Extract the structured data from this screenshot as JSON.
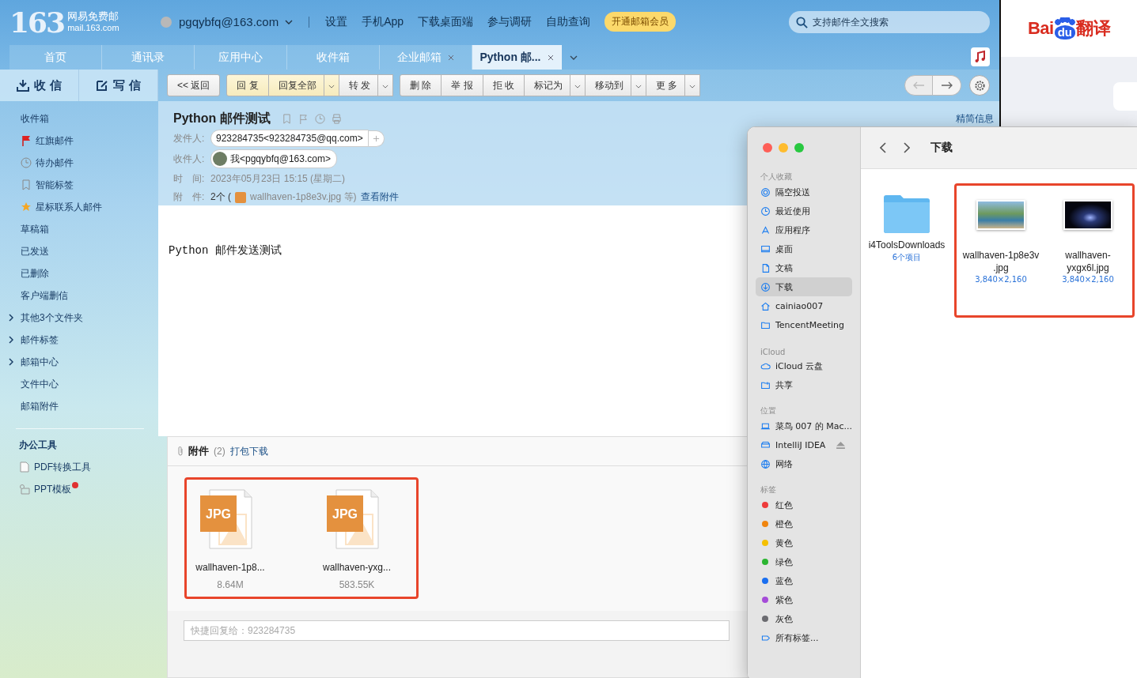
{
  "mail": {
    "logo": {
      "number": "163",
      "name": "网易免费邮",
      "domain": "mail.163.com"
    },
    "account": "pgqybfq@163.com",
    "top_links": [
      "设置",
      "手机App",
      "下载桌面端",
      "参与调研",
      "自助查询"
    ],
    "vip_button": "开通邮箱会员",
    "search": {
      "placeholder": "支持邮件全文搜索"
    },
    "nav_tabs": [
      {
        "label": "首页",
        "selected": false,
        "closable": false
      },
      {
        "label": "通讯录",
        "selected": false,
        "closable": false
      },
      {
        "label": "应用中心",
        "selected": false,
        "closable": false
      },
      {
        "label": "收件箱",
        "selected": false,
        "closable": false
      },
      {
        "label": "企业邮箱",
        "selected": false,
        "closable": true
      },
      {
        "label": "Python 邮...",
        "selected": true,
        "closable": true
      }
    ],
    "receive_button": "收 信",
    "compose_button": "写 信",
    "sidebar": [
      {
        "label": "收件箱",
        "kind": "plain"
      },
      {
        "label": "红旗邮件",
        "kind": "flag"
      },
      {
        "label": "待办邮件",
        "kind": "clock"
      },
      {
        "label": "智能标签",
        "kind": "bookmark"
      },
      {
        "label": "星标联系人邮件",
        "kind": "star"
      },
      {
        "label": "草稿箱",
        "kind": "plain"
      },
      {
        "label": "已发送",
        "kind": "plain"
      },
      {
        "label": "已删除",
        "kind": "plain"
      },
      {
        "label": "客户端删信",
        "kind": "plain"
      },
      {
        "label": "其他3个文件夹",
        "kind": "expandable"
      },
      {
        "label": "邮件标签",
        "kind": "expandable"
      },
      {
        "label": "邮箱中心",
        "kind": "expandable"
      },
      {
        "label": "文件中心",
        "kind": "plain"
      },
      {
        "label": "邮箱附件",
        "kind": "plain"
      }
    ],
    "tools_heading": "办公工具",
    "tools": [
      {
        "label": "PDF转换工具",
        "kind": "pdf",
        "badge": false
      },
      {
        "label": "PPT模板",
        "kind": "ppt",
        "badge": true
      }
    ],
    "back_button": "<< 返回",
    "toolbar_groups": [
      [
        {
          "label": "回 复",
          "highlighted": true,
          "dropdown": false
        },
        {
          "label": "回复全部",
          "highlighted": true,
          "dropdown": true
        },
        {
          "label": "转 发",
          "highlighted": false,
          "dropdown": true
        }
      ],
      [
        {
          "label": "删 除",
          "highlighted": false,
          "dropdown": false
        },
        {
          "label": "举 报",
          "highlighted": false,
          "dropdown": false
        },
        {
          "label": "拒 收",
          "highlighted": false,
          "dropdown": false
        },
        {
          "label": "标记为",
          "highlighted": false,
          "dropdown": true
        },
        {
          "label": "移动到",
          "highlighted": false,
          "dropdown": true
        },
        {
          "label": "更 多",
          "highlighted": false,
          "dropdown": true
        }
      ]
    ],
    "message": {
      "subject": "Python 邮件测试",
      "summary_link": "精简信息",
      "from_label": "发件人:",
      "from": "923284735<923284735@qq.com>",
      "to_label": "收件人:",
      "to": "我<pgqybfq@163.com>",
      "time_label": "时　间:",
      "time": "2023年05月23日 15:15 (星期二)",
      "attach_label": "附　件:",
      "attach_count": "2个 (",
      "attach_name": "wallhaven-1p8e3v.jpg 等)",
      "attach_link": "查看附件",
      "body": "Python 邮件发送测试"
    },
    "attachments": {
      "title": "附件",
      "count": "(2)",
      "download_all": "打包下载",
      "highlight": true,
      "files": [
        {
          "type": "JPG",
          "name": "wallhaven-1p8...",
          "size": "8.64M"
        },
        {
          "type": "JPG",
          "name": "wallhaven-yxg...",
          "size": "583.55K"
        }
      ]
    },
    "quick_reply": {
      "placeholder": "快捷回复给：923284735"
    }
  },
  "baidu_logo": {
    "left": "Bai",
    "paw": "du",
    "right": "翻译"
  },
  "finder": {
    "title": "下载",
    "sections": [
      {
        "heading": "个人收藏",
        "items": [
          {
            "label": "隔空投送",
            "kind": "airdrop",
            "selected": false
          },
          {
            "label": "最近使用",
            "kind": "recent",
            "selected": false
          },
          {
            "label": "应用程序",
            "kind": "apps",
            "selected": false
          },
          {
            "label": "桌面",
            "kind": "desktop",
            "selected": false
          },
          {
            "label": "文稿",
            "kind": "doc",
            "selected": false
          },
          {
            "label": "下载",
            "kind": "download",
            "selected": true
          },
          {
            "label": "cainiao007",
            "kind": "home",
            "selected": false
          },
          {
            "label": "TencentMeeting",
            "kind": "folder",
            "selected": false
          }
        ]
      },
      {
        "heading": "iCloud",
        "items": [
          {
            "label": "iCloud 云盘",
            "kind": "cloud",
            "selected": false
          },
          {
            "label": "共享",
            "kind": "shared",
            "selected": false
          }
        ]
      },
      {
        "heading": "位置",
        "items": [
          {
            "label": "菜鸟 007 的 Mac...",
            "kind": "laptop",
            "selected": false
          },
          {
            "label": "IntelliJ IDEA",
            "kind": "disk",
            "selected": false
          },
          {
            "label": "网络",
            "kind": "network",
            "selected": false
          }
        ]
      },
      {
        "heading": "标签",
        "items": [
          {
            "label": "红色",
            "kind": "tag",
            "color": "#ee3b3b",
            "selected": false
          },
          {
            "label": "橙色",
            "kind": "tag",
            "color": "#f0850f",
            "selected": false
          },
          {
            "label": "黄色",
            "kind": "tag",
            "color": "#f5c000",
            "selected": false
          },
          {
            "label": "绿色",
            "kind": "tag",
            "color": "#2bb531",
            "selected": false
          },
          {
            "label": "蓝色",
            "kind": "tag",
            "color": "#1a6ff0",
            "selected": false
          },
          {
            "label": "紫色",
            "kind": "tag",
            "color": "#a54cd8",
            "selected": false
          },
          {
            "label": "灰色",
            "kind": "tag",
            "color": "#6b6b70",
            "selected": false
          },
          {
            "label": "所有标签...",
            "kind": "alltags",
            "selected": false
          }
        ]
      }
    ],
    "folder": {
      "name": "i4ToolsDownloads",
      "info": "6个项目"
    },
    "images": {
      "highlight": true,
      "items": [
        {
          "name_lines": [
            "wallhaven-1p8e3v",
            ".jpg"
          ],
          "info": "3,840×2,160",
          "kind": "landscape"
        },
        {
          "name_lines": [
            "wallhaven-",
            "yxgx6l.jpg"
          ],
          "info": "3,840×2,160",
          "kind": "night"
        }
      ]
    }
  }
}
